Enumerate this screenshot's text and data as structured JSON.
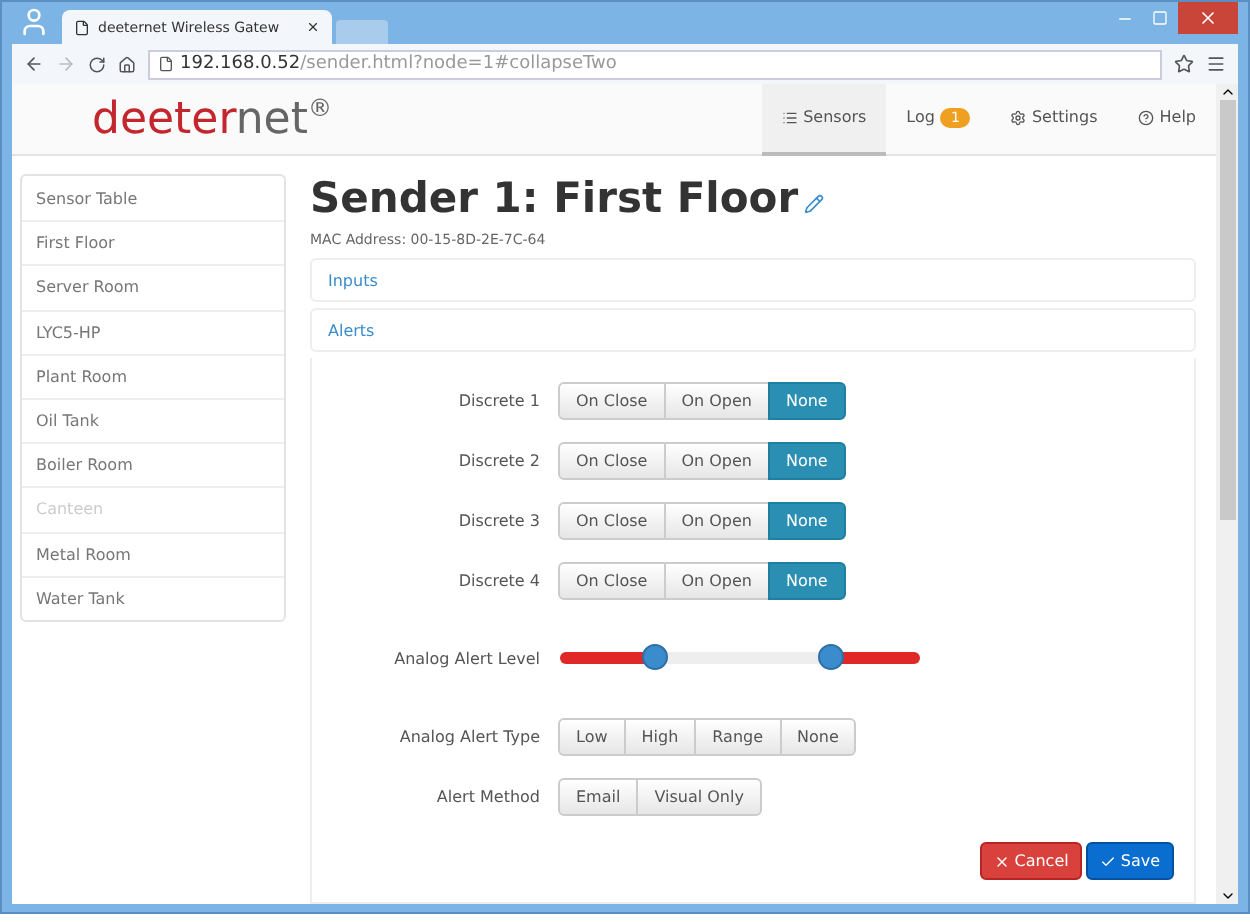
{
  "browser": {
    "tab_title": "deeternet Wireless Gatew",
    "url_host": "192.168.0.52",
    "url_path": "/sender.html?node=1#collapseTwo"
  },
  "brand": {
    "primary": "deeter",
    "secondary": "net",
    "mark": "®"
  },
  "nav": [
    {
      "label": "Sensors",
      "selected": true
    },
    {
      "label": "Log",
      "badge": "1",
      "selected": false
    },
    {
      "label": "Settings",
      "selected": false
    },
    {
      "label": "Help",
      "selected": false
    }
  ],
  "sidebar": {
    "items": [
      {
        "label": "Sensor Table",
        "disabled": false
      },
      {
        "label": "First Floor",
        "disabled": false
      },
      {
        "label": "Server Room",
        "disabled": false
      },
      {
        "label": "LYC5-HP",
        "disabled": false
      },
      {
        "label": "Plant Room",
        "disabled": false
      },
      {
        "label": "Oil Tank",
        "disabled": false
      },
      {
        "label": "Boiler Room",
        "disabled": false
      },
      {
        "label": "Canteen",
        "disabled": true
      },
      {
        "label": "Metal Room",
        "disabled": false
      },
      {
        "label": "Water Tank",
        "disabled": false
      }
    ]
  },
  "title": "Sender 1: First Floor",
  "mac": "MAC Address: 00-15-8D-2E-7C-64",
  "panels": [
    {
      "label": "Inputs"
    },
    {
      "label": "Alerts"
    }
  ],
  "alerts": [
    {
      "kind": "choice",
      "label": "Discrete 1",
      "options": [
        {
          "label": "On Close",
          "selected": false
        },
        {
          "label": "On Open",
          "selected": false
        },
        {
          "label": "None",
          "selected": true
        }
      ]
    },
    {
      "kind": "choice",
      "label": "Discrete 2",
      "options": [
        {
          "label": "On Close",
          "selected": false
        },
        {
          "label": "On Open",
          "selected": false
        },
        {
          "label": "None",
          "selected": true
        }
      ]
    },
    {
      "kind": "choice",
      "label": "Discrete 3",
      "options": [
        {
          "label": "On Close",
          "selected": false
        },
        {
          "label": "On Open",
          "selected": false
        },
        {
          "label": "None",
          "selected": true
        }
      ]
    },
    {
      "kind": "choice",
      "label": "Discrete 4",
      "options": [
        {
          "label": "On Close",
          "selected": false
        },
        {
          "label": "On Open",
          "selected": false
        },
        {
          "label": "None",
          "selected": true
        }
      ]
    },
    {
      "kind": "range",
      "label": "Analog Alert Level",
      "low": {
        "level": 0.26
      },
      "high": {
        "level": 0.75
      }
    },
    {
      "kind": "choice",
      "label": "Analog Alert Type",
      "options": [
        {
          "label": "Low",
          "selected": false
        },
        {
          "label": "High",
          "selected": false
        },
        {
          "label": "Range",
          "selected": false
        },
        {
          "label": "None",
          "selected": false
        }
      ]
    },
    {
      "kind": "choice",
      "label": "Alert Method",
      "options": [
        {
          "label": "Email",
          "selected": false
        },
        {
          "label": "Visual Only",
          "selected": false
        }
      ]
    }
  ],
  "actions": [
    {
      "kind": "cancel",
      "label": "Cancel"
    },
    {
      "kind": "save",
      "label": "Save"
    }
  ]
}
